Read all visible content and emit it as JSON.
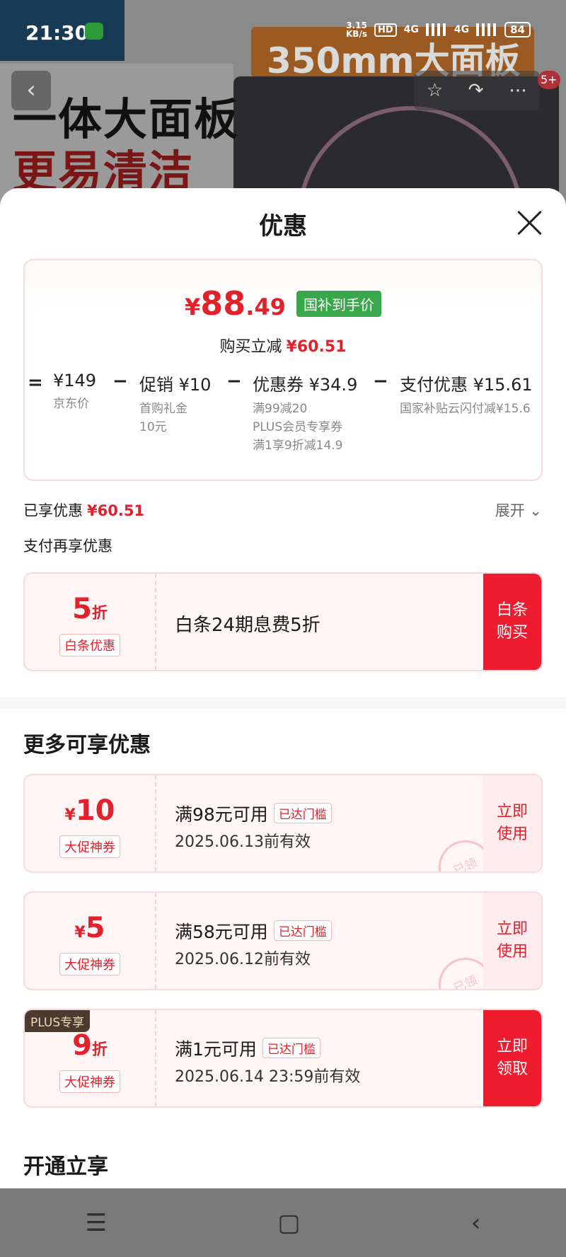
{
  "background": {
    "headline1": "一体大面板",
    "headline2": "更易清洁",
    "banner": "350mm大面板",
    "icons": [
      "star-icon",
      "share-icon",
      "more-icon"
    ],
    "cart_badge": "5+"
  },
  "status_bar": {
    "time": "21:30",
    "speed": "3.15",
    "speed_unit": "KB/s",
    "hd": "HD",
    "net1": "4G",
    "net2": "4G",
    "battery": "84"
  },
  "sheet": {
    "title": "优惠",
    "price": {
      "currency": "¥",
      "int": "88",
      "dec": ".49",
      "tag": "国补到手价",
      "saved_label": "购买立减",
      "saved_value": "¥60.51"
    },
    "breakdown": {
      "eq": "=",
      "minus": "−",
      "items": [
        {
          "main": "¥149",
          "sub": "京东价"
        },
        {
          "main": "促销 ¥10",
          "sub": "首购礼金",
          "sub2": "10元"
        },
        {
          "main": "优惠券 ¥34.9",
          "sub": "满99减20",
          "sub2": "PLUS会员专享券",
          "sub3": "满1享9折减14.9"
        },
        {
          "main": "支付优惠 ¥15.61",
          "sub": "国家补贴云闪付减¥15.6"
        }
      ]
    },
    "enjoyed_label": "已享优惠",
    "enjoyed_value": "¥60.51",
    "expand_label": "展开",
    "pay_more_label": "支付再享优惠",
    "baitiao": {
      "amount": "5",
      "unit": "折",
      "tag": "白条优惠",
      "text": "白条24期息费5折",
      "cta": "白条购买"
    },
    "more_title": "更多可享优惠",
    "coupons": [
      {
        "currency": "¥",
        "amount": "10",
        "tag": "大促神券",
        "title": "满98元可用",
        "reached": "已达门槛",
        "valid": "2025.06.13前有效",
        "cta": "立即使用",
        "stamp": "已领"
      },
      {
        "currency": "¥",
        "amount": "5",
        "tag": "大促神券",
        "title": "满58元可用",
        "reached": "已达门槛",
        "valid": "2025.06.12前有效",
        "cta": "立即使用",
        "stamp": "已领"
      },
      {
        "plus": "PLUS专享",
        "amount": "9",
        "unit": "折",
        "tag": "大促神券",
        "title": "满1元可用",
        "reached": "已达门槛",
        "valid": "2025.06.14 23:59前有效",
        "cta": "立即领取"
      }
    ],
    "open_title": "开通立享"
  },
  "nav": {
    "menu": "☰",
    "home": "▢",
    "back": "‹"
  }
}
